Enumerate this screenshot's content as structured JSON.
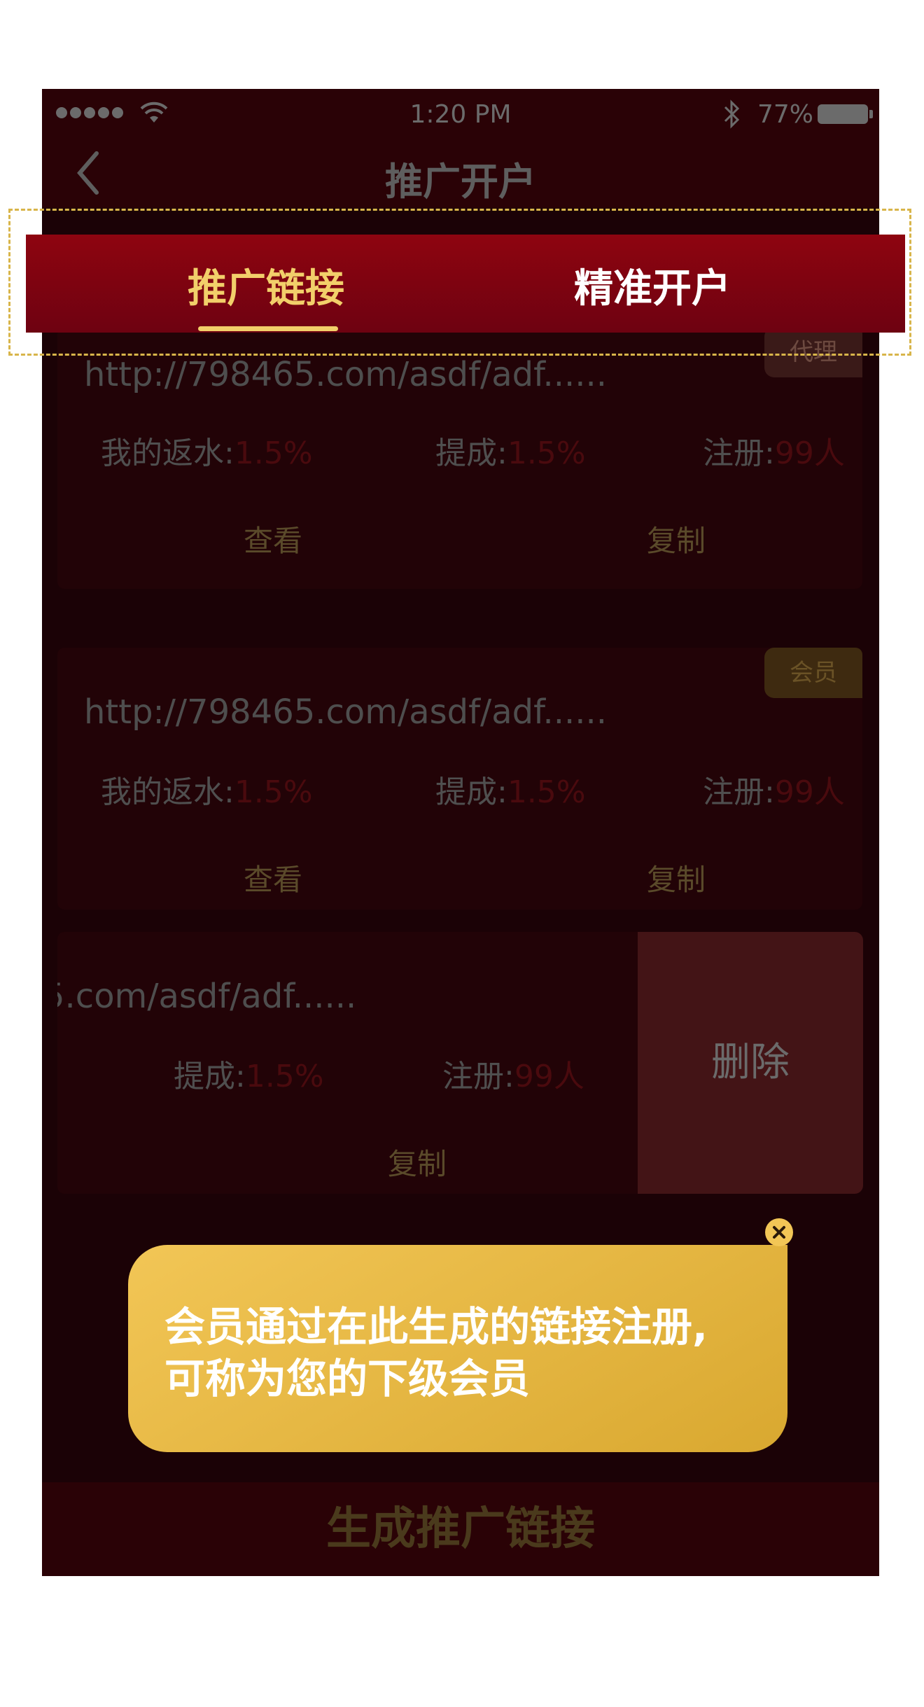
{
  "status_bar": {
    "time": "1:20 PM",
    "battery": "77%"
  },
  "nav": {
    "title": "推广开户"
  },
  "tabs": [
    {
      "label": "推广链接",
      "active": true
    },
    {
      "label": "精准开户",
      "active": false
    }
  ],
  "cards": [
    {
      "badge": "代理",
      "url": "http://798465.com/asdf/adf......",
      "rebate_label": "我的返水:",
      "rebate_value": "1.5%",
      "commission_label": "提成:",
      "commission_value": "1.5%",
      "register_label": "注册:",
      "register_value": "99人",
      "view_label": "查看",
      "copy_label": "复制"
    },
    {
      "badge": "会员",
      "url": "http://798465.com/asdf/adf......",
      "rebate_label": "我的返水:",
      "rebate_value": "1.5%",
      "commission_label": "提成:",
      "commission_value": "1.5%",
      "register_label": "注册:",
      "register_value": "99人",
      "view_label": "查看",
      "copy_label": "复制"
    },
    {
      "url": "5.com/asdf/adf......",
      "commission_label": "提成:",
      "commission_value": "1.5%",
      "register_label": "注册:",
      "register_value": "99人",
      "copy_label": "复制",
      "delete_label": "删除"
    }
  ],
  "bottom_button": {
    "label": "生成推广链接"
  },
  "tooltip": {
    "line1": "会员通过在此生成的链接注册,",
    "line2": "可称为您的下级会员"
  }
}
